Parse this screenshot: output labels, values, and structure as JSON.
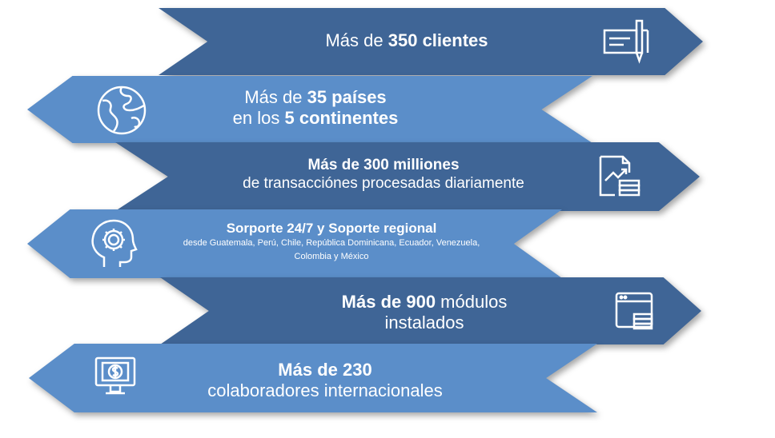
{
  "rows": [
    {
      "pre": "Más de ",
      "bold": "350 clientes",
      "line2": "",
      "icon": "check-ledger-icon"
    },
    {
      "pre": "Más de ",
      "bold": "35 países",
      "line2_pre": "en los ",
      "line2_bold": "5 continentes",
      "icon": "globe-icon"
    },
    {
      "bold": "Más de 300 milliones",
      "line2": "de transacciónes procesadas diariamente",
      "icon": "finance-report-icon"
    },
    {
      "bold": "Sorporte 24/7 y Soporte regional",
      "line2": "desde Guatemala, Perú, Chile, República Dominicana, Ecuador, Venezuela,",
      "line3": "Colombia y México",
      "icon": "gear-head-icon"
    },
    {
      "bold": "Más de 900",
      "post": " módulos",
      "line2": "instalados",
      "icon": "module-window-icon"
    },
    {
      "bold": "Más de 230",
      "line2": "colaboradores internacionales",
      "icon": "dollar-monitor-icon"
    }
  ],
  "colors": {
    "dark": "#3f6596",
    "light": "#5b8ec9"
  }
}
